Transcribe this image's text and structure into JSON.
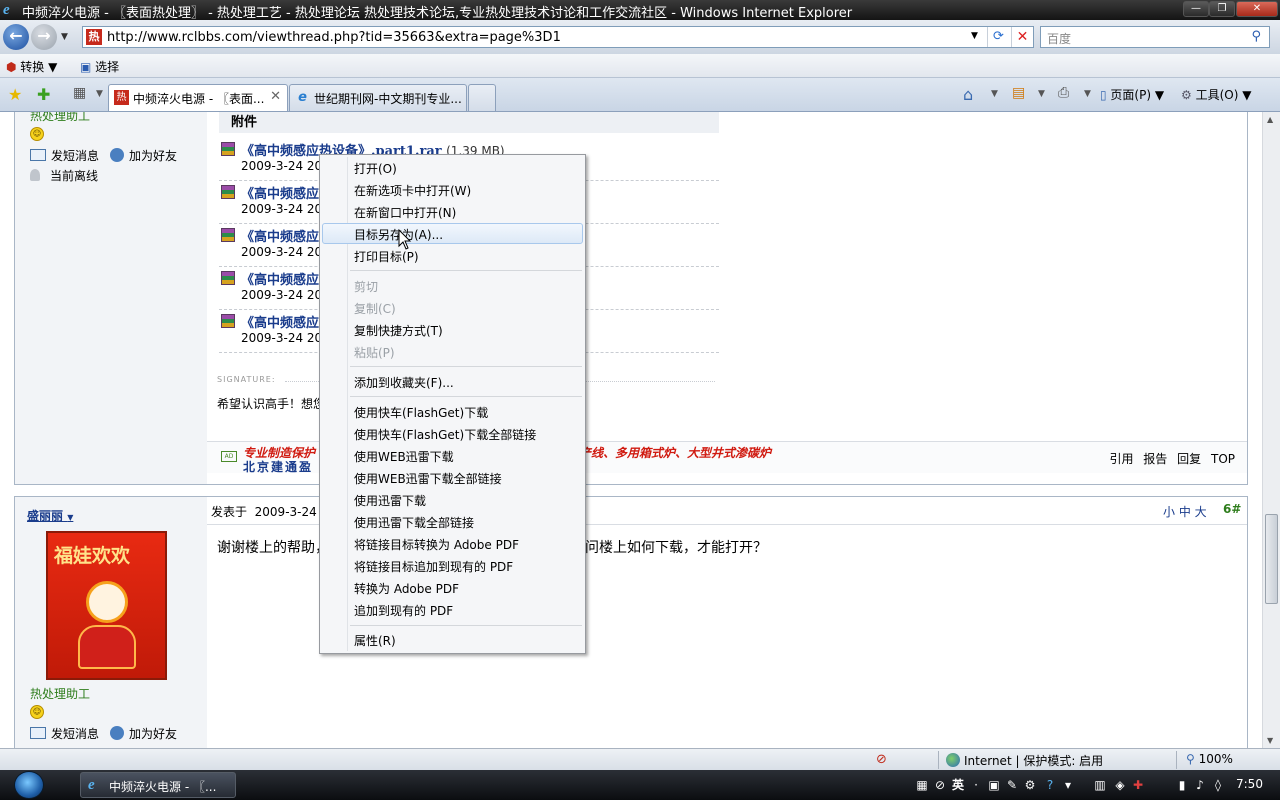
{
  "window": {
    "title": "中频淬火电源 - 〖表面热处理〗 - 热处理工艺 - 热处理论坛 热处理技术论坛,专业热处理技术讨论和工作交流社区 - Windows Internet Explorer",
    "minimize": "—",
    "maximize": "❐",
    "close": "✕"
  },
  "address": {
    "url": "http://www.rclbbs.com/viewthread.php?tid=35663&extra=page%3D1",
    "site_icon": "热",
    "search_placeholder": "百度"
  },
  "command_bar": {
    "convert_label": "转换",
    "select_label": "选择"
  },
  "tabs": [
    {
      "label": "中频淬火电源 - 〖表面...",
      "icon": "热",
      "active": true
    },
    {
      "label": "世纪期刊网-中文期刊专业...",
      "icon": "e",
      "active": false
    }
  ],
  "toolbar_right": {
    "page_label": "页面(P)",
    "tools_label": "工具(O)"
  },
  "post1": {
    "user_title": "热处理助工",
    "send_msg": "发短消息",
    "add_friend": "加为好友",
    "status": "当前离线",
    "attachments_header": "附件",
    "attachments": [
      {
        "name": "《高中频感应热设备》.part1.rar",
        "size": "(1.39 MB)",
        "date": "2009-3-24 20:1"
      },
      {
        "name": "《高中频感应热",
        "size": "",
        "date": "2009-3-24 20:1"
      },
      {
        "name": "《高中频感应热",
        "size": "",
        "date": "2009-3-24 20:2"
      },
      {
        "name": "《高中频感应热",
        "size": "",
        "date": "2009-3-24 20:2"
      },
      {
        "name": "《高中频感应热",
        "size": "",
        "date": "2009-3-24 20:2"
      }
    ],
    "signature_label": "SIGNATURE:",
    "signature_text": "希望认识高手！想您",
    "ad_badge": "AD",
    "ad_line1": "专业制造保护",
    "ad_line1_right": "产线、多用箱式炉、大型井式渗碳炉",
    "ad_line2": "北京建通盈",
    "actions": [
      "引用",
      "报告",
      "回复",
      "TOP"
    ]
  },
  "post2": {
    "author": "盛丽丽",
    "avatar_text": "福娃欢欢",
    "user_title": "热处理助工",
    "send_msg": "发短消息",
    "add_friend": "加为好友",
    "posted_prefix": "发表于",
    "posted_date": "2009-3-24 2",
    "font_sizes": "小 中 大",
    "floor": "6#",
    "text_left": "谢谢楼上的帮助，",
    "text_right": "问楼上如何下载，才能打开？"
  },
  "context_menu": {
    "items": [
      {
        "label": "打开(O)",
        "disabled": false
      },
      {
        "label": "在新选项卡中打开(W)",
        "disabled": false
      },
      {
        "label": "在新窗口中打开(N)",
        "disabled": false
      },
      {
        "label": "目标另存为(A)...",
        "disabled": false,
        "hover": true
      },
      {
        "label": "打印目标(P)",
        "disabled": false
      },
      {
        "label": "剪切",
        "disabled": true
      },
      {
        "label": "复制(C)",
        "disabled": true
      },
      {
        "label": "复制快捷方式(T)",
        "disabled": false
      },
      {
        "label": "粘贴(P)",
        "disabled": true
      },
      {
        "label": "添加到收藏夹(F)...",
        "disabled": false
      },
      {
        "label": "使用快车(FlashGet)下载",
        "disabled": false
      },
      {
        "label": "使用快车(FlashGet)下载全部链接",
        "disabled": false
      },
      {
        "label": "使用WEB迅雷下载",
        "disabled": false
      },
      {
        "label": "使用WEB迅雷下载全部链接",
        "disabled": false
      },
      {
        "label": "使用迅雷下载",
        "disabled": false
      },
      {
        "label": "使用迅雷下载全部链接",
        "disabled": false
      },
      {
        "label": "将链接目标转换为 Adobe PDF",
        "disabled": false
      },
      {
        "label": "将链接目标追加到现有的 PDF",
        "disabled": false
      },
      {
        "label": "转换为 Adobe PDF",
        "disabled": false
      },
      {
        "label": "追加到现有的 PDF",
        "disabled": false
      },
      {
        "label": "属性(R)",
        "disabled": false
      }
    ]
  },
  "status_bar": {
    "zone": "Internet | 保护模式: 启用",
    "zoom": "100%"
  },
  "taskbar": {
    "window_item": "中频淬火电源 - 〖...",
    "ime": "英",
    "clock": "7:50"
  },
  "colors": {
    "accent": "#1a3c8c",
    "ad_red": "#d01a10",
    "user_green": "#2e7d1c"
  }
}
